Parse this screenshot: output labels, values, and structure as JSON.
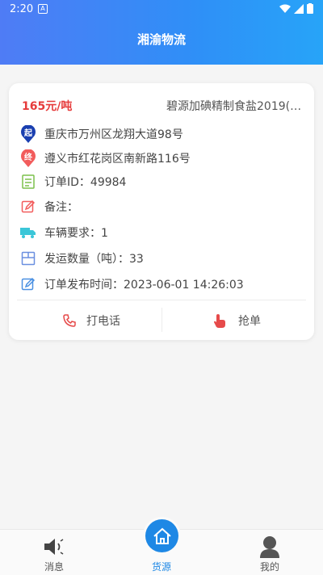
{
  "status_bar": {
    "time": "2:20",
    "notif_icon_letter": "A"
  },
  "header": {
    "title": "湘渝物流"
  },
  "card": {
    "price": "165元/吨",
    "product": "碧源加碘精制食盐2019(…",
    "origin_badge": "起",
    "origin": "重庆市万州区龙翔大道98号",
    "dest_badge": "终",
    "destination": "遵义市红花岗区南新路116号",
    "order_id": "订单ID：49984",
    "remark": "备注：",
    "vehicle": "车辆要求：1",
    "quantity": "发运数量（吨）：33",
    "publish_time": "订单发布时间：2023-06-01 14:26:03",
    "call_label": "打电话",
    "grab_label": "抢单"
  },
  "colors": {
    "accent": "#1e88e5",
    "price": "#e63b3b",
    "header_start": "#4f7cf5",
    "header_end": "#27a4f8"
  },
  "bottom_nav": {
    "items": [
      {
        "label": "消息",
        "icon": "speaker-icon"
      },
      {
        "label": "货源",
        "icon": "home-icon"
      },
      {
        "label": "我的",
        "icon": "user-icon"
      }
    ],
    "active_index": 1
  }
}
